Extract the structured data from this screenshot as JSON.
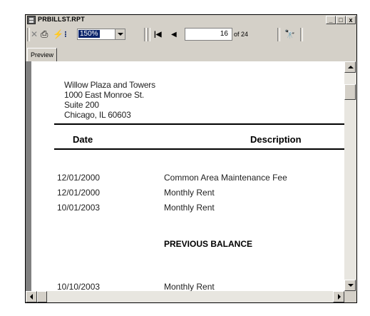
{
  "window": {
    "title": "PRBILLST.RPT",
    "controls": {
      "minimize": "_",
      "restore": "□",
      "close": "x"
    }
  },
  "toolbar": {
    "icons": [
      "close-icon",
      "print-icon",
      "refresh-icon",
      "group-tree-icon",
      "first-page-icon",
      "previous-page-icon",
      "search-icon"
    ],
    "close_glyph": "✕",
    "print_glyph": "⎙",
    "refresh_glyph": "⚡",
    "tree_glyph": "⁝",
    "first_glyph": "|◀",
    "prev_glyph": "◀",
    "search_glyph": "🔭",
    "zoom": {
      "value": "150%"
    },
    "page": {
      "current": "16",
      "total_label": "of 24"
    }
  },
  "tabs": [
    {
      "label": "Preview"
    }
  ],
  "report": {
    "address": [
      "Willow Plaza and Towers",
      "1000 East Monroe St.",
      "Suite 200",
      "Chicago, IL 60603"
    ],
    "columns": {
      "date": "Date",
      "description": "Description"
    },
    "rows": [
      {
        "date": "12/01/2000",
        "description": "Common Area Maintenance Fee"
      },
      {
        "date": "12/01/2000",
        "description": "Monthly Rent"
      },
      {
        "date": "10/01/2003",
        "description": "Monthly Rent"
      },
      {
        "date": "10/10/2003",
        "description": "Monthly Rent"
      }
    ],
    "section_label": "PREVIOUS BALANCE"
  },
  "colors": {
    "selection": "#0a246a",
    "chrome": "#d4d0c8",
    "frame": "#808080"
  }
}
